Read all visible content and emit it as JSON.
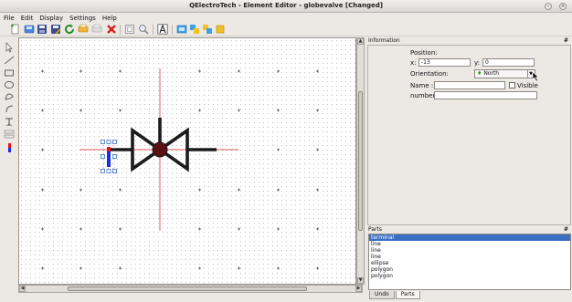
{
  "window": {
    "title": "QElectroTech - Element Editor - globevalve [Changed]"
  },
  "menubar": {
    "items": [
      {
        "label": "File"
      },
      {
        "label": "Edit"
      },
      {
        "label": "Display"
      },
      {
        "label": "Settings"
      },
      {
        "label": "Help"
      }
    ]
  },
  "toolbar": {
    "icons": [
      "new-icon",
      "open-icon",
      "save-icon",
      "save-as-icon",
      "reload-icon",
      "copy-icon",
      "paste-icon",
      "delete-icon",
      "zoom-fit-icon",
      "zoom-icon",
      "text-icon",
      "tool-a-icon",
      "tool-b-icon",
      "tool-c-icon",
      "tool-d-icon"
    ]
  },
  "left_tools": {
    "icons": [
      "pointer-icon",
      "line-icon",
      "rectangle-icon",
      "ellipse-icon",
      "circle-icon",
      "arc-icon",
      "text-icon",
      "textfield-icon",
      "terminal-icon"
    ]
  },
  "colors": {
    "selection": "#3b6fc2",
    "terminal_blue": "#1a2ee6",
    "terminal_red": "#ee1111",
    "axis_red": "#d52020",
    "symbol": "#1b1b1b"
  },
  "information": {
    "title": "Information",
    "position_label": "Position:",
    "x_label": "x:",
    "x_value": "-13",
    "y_label": "y:",
    "y_value": "0",
    "orientation_label": "Orientation:",
    "orientation_value": "North",
    "name_label": "Name :",
    "name_value": "",
    "visible_label": "Visible",
    "visible_checked": false,
    "number_label": "number:",
    "number_value": ""
  },
  "parts": {
    "title": "Parts",
    "items": [
      {
        "label": "terminal",
        "selected": true
      },
      {
        "label": "line",
        "selected": false
      },
      {
        "label": "line",
        "selected": false
      },
      {
        "label": "line",
        "selected": false
      },
      {
        "label": "ellipse",
        "selected": false
      },
      {
        "label": "polygon",
        "selected": false
      },
      {
        "label": "polygon",
        "selected": false
      }
    ],
    "tabs": [
      {
        "label": "Undo",
        "active": false
      },
      {
        "label": "Parts",
        "active": true
      }
    ]
  }
}
